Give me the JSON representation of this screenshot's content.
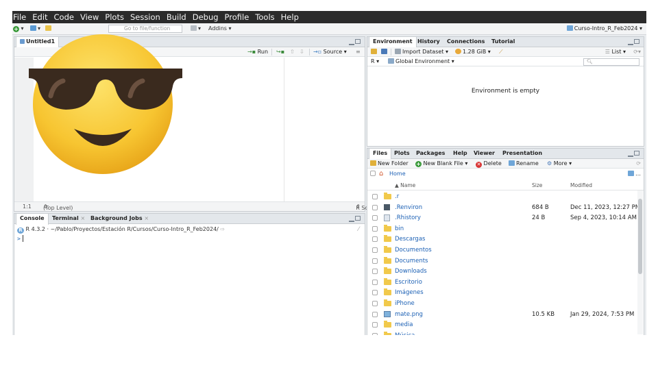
{
  "menu": [
    "File",
    "Edit",
    "Code",
    "View",
    "Plots",
    "Session",
    "Build",
    "Debug",
    "Profile",
    "Tools",
    "Help"
  ],
  "toolbar": {
    "go_to_placeholder": "Go to file/function",
    "addins_label": "Addins",
    "project_label": "Curso-Intro_R_Feb2024"
  },
  "source": {
    "tab_label": "Untitled1",
    "run_label": "Run",
    "source_label": "Source",
    "cursor_position": "1:1",
    "scope": "(Top Level)",
    "file_type": "R Script"
  },
  "console": {
    "tabs": [
      "Console",
      "Terminal",
      "Background Jobs"
    ],
    "version": "R 4.3.2",
    "path": "~/Pablo/Proyectos/Estación R/Cursos/Curso-Intro_R_Feb2024/",
    "prompt": ">"
  },
  "environment": {
    "tabs": [
      "Environment",
      "History",
      "Connections",
      "Tutorial"
    ],
    "import_label": "Import Dataset",
    "memory": "1.28 GiB",
    "view_label": "List",
    "lang": "R",
    "scope_label": "Global Environment",
    "empty_message": "Environment is empty"
  },
  "files": {
    "tabs": [
      "Files",
      "Plots",
      "Packages",
      "Help",
      "Viewer",
      "Presentation"
    ],
    "new_folder": "New Folder",
    "new_blank_file": "New Blank File",
    "delete": "Delete",
    "rename": "Rename",
    "more": "More",
    "breadcrumb": "Home",
    "columns": {
      "name": "▲ Name",
      "size": "Size",
      "modified": "Modified"
    },
    "rows": [
      {
        "name": ".r",
        "size": "",
        "modified": "",
        "icon": "folder-icon"
      },
      {
        "name": ".Renviron",
        "size": "684 B",
        "modified": "Dec 11, 2023, 12:27 PM",
        "icon": "r-file-icon"
      },
      {
        "name": ".Rhistory",
        "size": "24 B",
        "modified": "Sep 4, 2023, 10:14 AM",
        "icon": "history-file-icon"
      },
      {
        "name": "bin",
        "size": "",
        "modified": "",
        "icon": "folder-icon"
      },
      {
        "name": "Descargas",
        "size": "",
        "modified": "",
        "icon": "folder-icon"
      },
      {
        "name": "Documentos",
        "size": "",
        "modified": "",
        "icon": "folder-icon"
      },
      {
        "name": "Documents",
        "size": "",
        "modified": "",
        "icon": "folder-icon"
      },
      {
        "name": "Downloads",
        "size": "",
        "modified": "",
        "icon": "folder-icon"
      },
      {
        "name": "Escritorio",
        "size": "",
        "modified": "",
        "icon": "folder-icon"
      },
      {
        "name": "Imágenes",
        "size": "",
        "modified": "",
        "icon": "folder-icon"
      },
      {
        "name": "iPhone",
        "size": "",
        "modified": "",
        "icon": "folder-icon"
      },
      {
        "name": "mate.png",
        "size": "10.5 KB",
        "modified": "Jan 29, 2024, 7:53 PM",
        "icon": "image-file-icon"
      },
      {
        "name": "media",
        "size": "",
        "modified": "",
        "icon": "folder-icon"
      },
      {
        "name": "Música",
        "size": "",
        "modified": "",
        "icon": "folder-icon"
      }
    ]
  },
  "colors": {
    "menubar": "#2b2b2b",
    "link_blue": "#1a5fb4",
    "emoji_yellow": "#f7c531",
    "sunglasses": "#3a2a1e"
  }
}
